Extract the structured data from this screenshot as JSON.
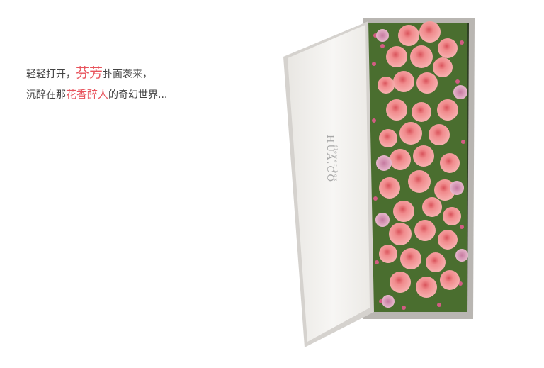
{
  "tagline": {
    "line1_prefix": "轻轻打开，",
    "line1_highlight": "芬芳",
    "line1_suffix": "扑面袭来，",
    "line2_prefix": "沉醉在那",
    "line2_highlight": "花香醉人",
    "line2_suffix": "的奇幻世界..."
  },
  "product": {
    "brand_mark": "HUA.CO",
    "brand_sub": "flower box"
  },
  "colors": {
    "accent": "#e8535c",
    "box": "#f4f3f1",
    "rose": "#f08c8e",
    "foliage": "#3f6a2a"
  }
}
